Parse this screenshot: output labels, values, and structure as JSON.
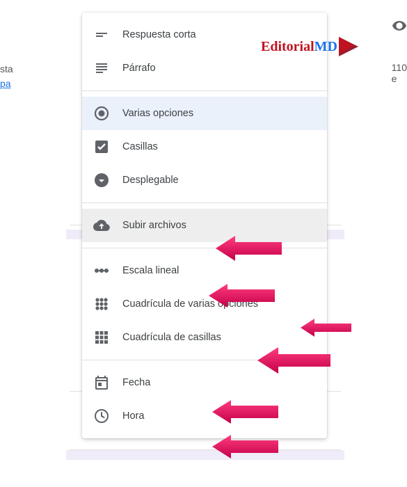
{
  "background": {
    "text_snip1": "sta",
    "text_snip2": "pa",
    "text_snip3": "e",
    "number": "110"
  },
  "watermark": {
    "label_part1": "Editorial",
    "label_part2": "MD"
  },
  "menu": {
    "items": [
      {
        "label": "Respuesta corta",
        "icon": "short-text-icon"
      },
      {
        "label": "Párrafo",
        "icon": "paragraph-icon"
      },
      {
        "label": "Varias opciones",
        "icon": "radio-icon",
        "selected": true
      },
      {
        "label": "Casillas",
        "icon": "checkbox-icon"
      },
      {
        "label": "Desplegable",
        "icon": "dropdown-icon"
      },
      {
        "label": "Subir archivos",
        "icon": "cloud-upload-icon",
        "highlighted": true
      },
      {
        "label": "Escala lineal",
        "icon": "linear-scale-icon"
      },
      {
        "label": "Cuadrícula de varias opciones",
        "icon": "radio-grid-icon"
      },
      {
        "label": "Cuadrícula de casillas",
        "icon": "checkbox-grid-icon"
      },
      {
        "label": "Fecha",
        "icon": "date-icon"
      },
      {
        "label": "Hora",
        "icon": "time-icon"
      }
    ]
  }
}
